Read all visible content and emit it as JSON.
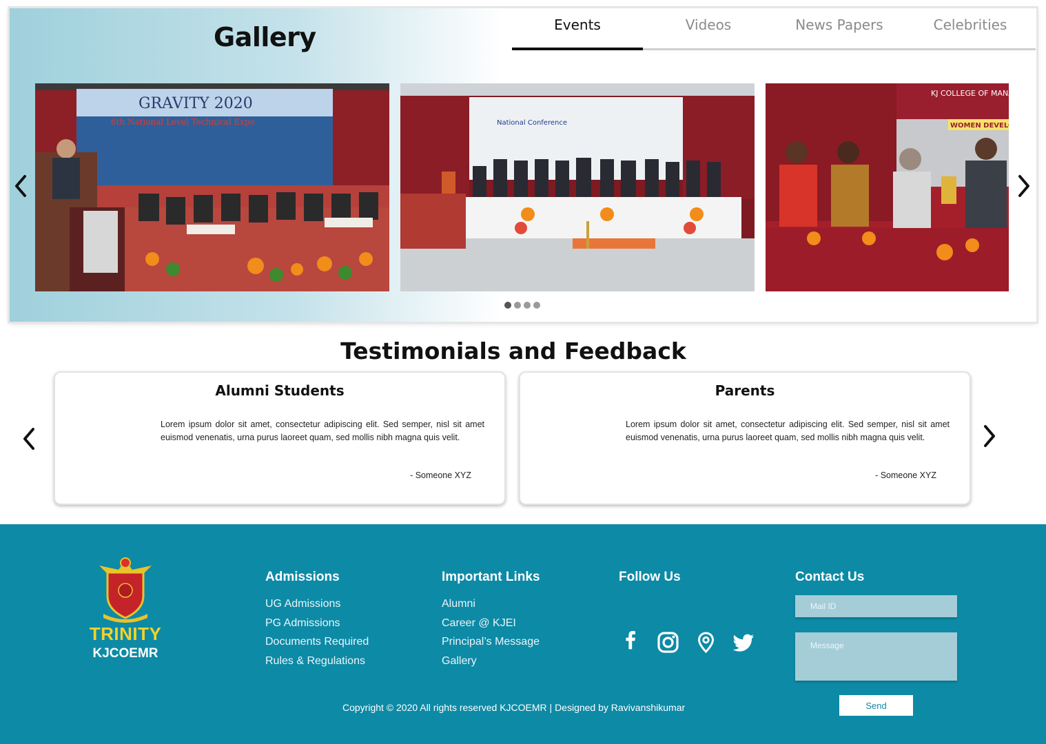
{
  "gallery": {
    "title": "Gallery",
    "tabs": [
      {
        "label": "Events",
        "active": true
      },
      {
        "label": "Videos",
        "active": false
      },
      {
        "label": "News Papers",
        "active": false
      },
      {
        "label": "Celebrities",
        "active": false
      }
    ],
    "prev_icon": "chevron-left-icon",
    "next_icon": "chevron-right-icon",
    "photos": [
      {
        "banner_text": "GRAVITY 2020",
        "sub_text": "6th National Level Technical Expo"
      },
      {
        "banner_text": "National Conference"
      },
      {
        "banner_text": "KJ COLLEGE OF MANAGEMENT",
        "sub_text": "WOMEN DEVELO"
      }
    ],
    "carousel_dots": 4,
    "active_dot": 0
  },
  "testimonials": {
    "title": "Testimonials and Feedback",
    "cards": [
      {
        "heading": "Alumni Students",
        "text": "Lorem ipsum dolor sit amet, consectetur adipiscing elit. Sed semper, nisl sit amet euismod venenatis, urna purus laoreet quam, sed mollis nibh magna quis velit.",
        "author": "- Someone XYZ"
      },
      {
        "heading": "Parents",
        "text": "Lorem ipsum dolor sit amet, consectetur adipiscing elit. Sed semper, nisl sit amet euismod venenatis, urna purus laoreet quam, sed mollis nibh magna quis velit.",
        "author": "- Someone XYZ"
      }
    ]
  },
  "footer": {
    "brand": "TRINITY",
    "brand_sub": "KJCOEMR",
    "admissions": {
      "heading": "Admissions",
      "links": [
        "UG Admissions",
        "PG Admissions",
        "Documents Required",
        "Rules & Regulations"
      ]
    },
    "important_links": {
      "heading": "Important Links",
      "links": [
        "Alumni",
        "Career @ KJEI",
        "Principal’s Message",
        "Gallery"
      ]
    },
    "follow": {
      "heading": "Follow Us",
      "icons": [
        "facebook-icon",
        "instagram-icon",
        "location-pin-icon",
        "twitter-icon"
      ]
    },
    "contact": {
      "heading": "Contact Us",
      "mail_placeholder": "Mail ID",
      "message_placeholder": "Message",
      "send_label": "Send"
    },
    "copyright": "Copyright © 2020 All rights reserved KJCOEMR | Designed by Ravivanshikumar"
  },
  "colors": {
    "footer_bg": "#0d8aa6",
    "brand_yellow": "#f2d22b",
    "input_bg": "#a5cdd8"
  }
}
